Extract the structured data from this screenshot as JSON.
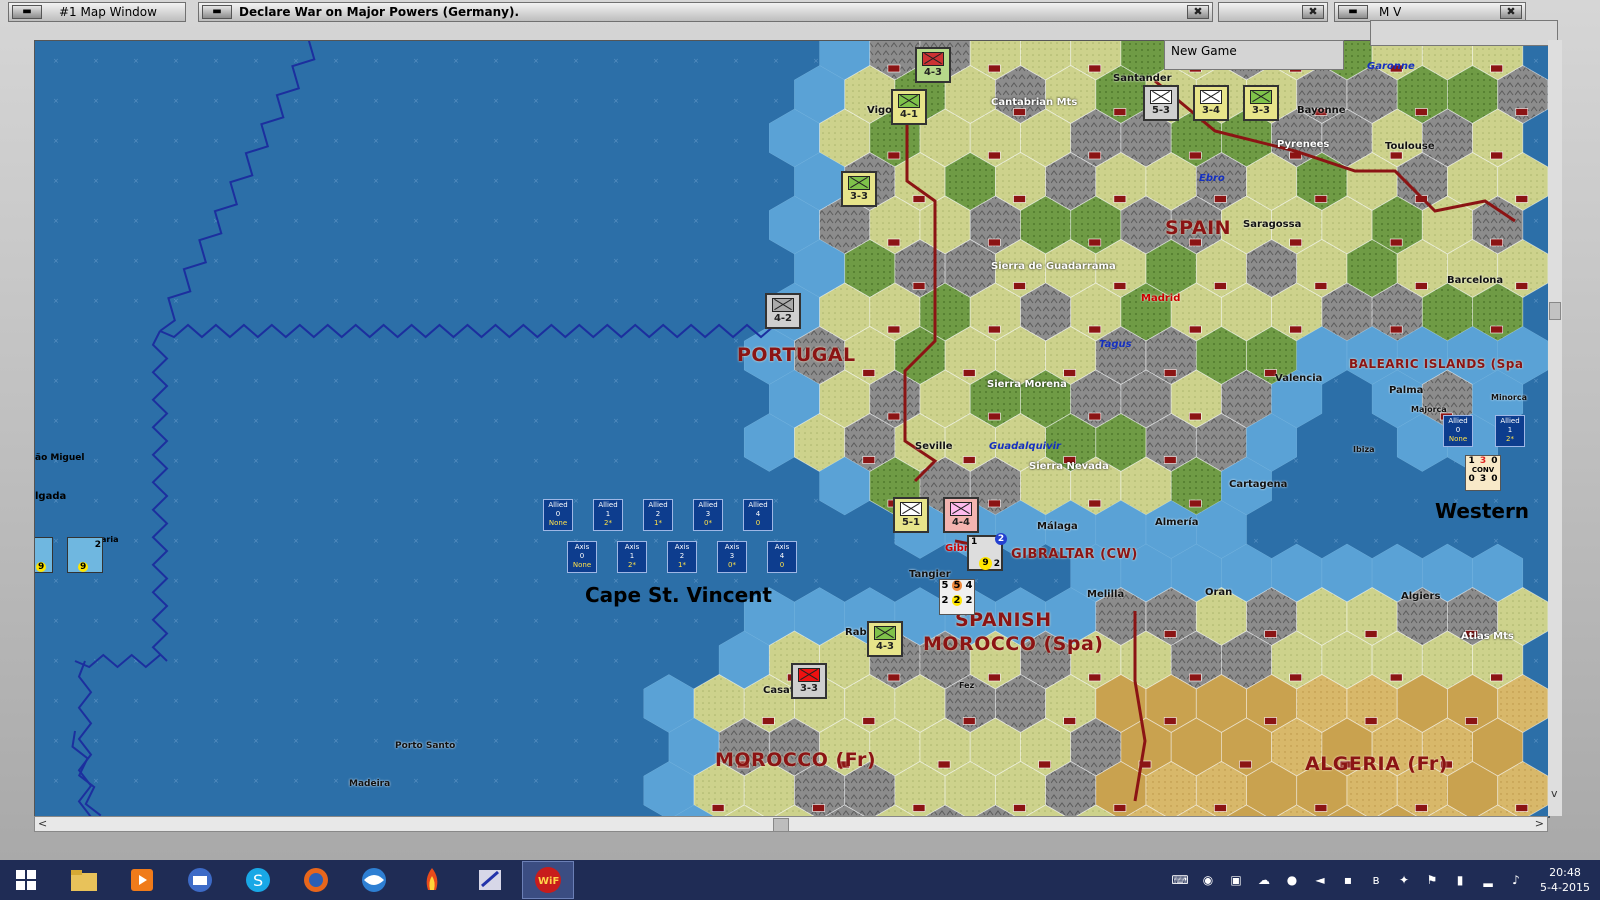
{
  "windows": {
    "map_window_title": "#1 Map Window",
    "main_title": "Declare War on Major Powers (Germany).",
    "new_game": "New Game",
    "mv_title": "M V"
  },
  "close_glyph": "✖",
  "map": {
    "countries": {
      "spain": "SPAIN",
      "portugal": "PORTUGAL",
      "spanish_morocco_1": "SPANISH",
      "spanish_morocco_2": "MOROCCO (Spa)",
      "morocco": "MOROCCO (Fr)",
      "algeria": "ALGERIA (Fr)",
      "gibraltar": "GIBRALTAR (CW)",
      "balearic": "BALEARIC ISLANDS (Spa",
      "western": "Western"
    },
    "sea_zone": "Cape St. Vincent",
    "cities": {
      "santander": "Santander",
      "vigo": "Vigo",
      "bayonne": "Bayonne",
      "toulouse": "Toulouse",
      "saragossa": "Saragossa",
      "barcelona": "Barcelona",
      "madrid": "Madrid",
      "valencia": "Valencia",
      "palma": "Palma",
      "minorca": "Minorca",
      "majorca": "Majorca",
      "ibiza": "Ibiza",
      "seville": "Seville",
      "cartagena": "Cartagena",
      "malaga": "Málaga",
      "almeria": "Almería",
      "gibraltar_city": "Gibr",
      "tangier": "Tangier",
      "melilla": "Melilla",
      "oran": "Oran",
      "algiers": "Algiers",
      "rabat": "Rab",
      "casablanca": "Casat",
      "fez": "Fez",
      "porto_santo": "Porto Santo",
      "madeira": "Madeira",
      "sao_miguel": "ão Miguel",
      "delgada": "lgada",
      "santa_maria": "aria"
    },
    "terrain": {
      "cantabrian": "Cantabrian Mts",
      "pyrenees": "Pyrenees",
      "guadarrama": "Sierra de Guadarrama",
      "morena": "Sierra Morena",
      "nevada": "Sierra Nevada",
      "atlas": "Atlas Mts"
    },
    "rivers": {
      "garonne": "Garonne",
      "ebro": "Ebro",
      "tagus": "Tagus",
      "guadalquivir": "Guadalquivir"
    }
  },
  "sea_boxes": {
    "allied": [
      {
        "side": "Allied",
        "num": "0",
        "status": "None"
      },
      {
        "side": "Allied",
        "num": "1",
        "status": "2*"
      },
      {
        "side": "Allied",
        "num": "2",
        "status": "1*"
      },
      {
        "side": "Allied",
        "num": "3",
        "status": "0*"
      },
      {
        "side": "Allied",
        "num": "4",
        "status": "0"
      }
    ],
    "axis": [
      {
        "side": "Axis",
        "num": "0",
        "status": "None"
      },
      {
        "side": "Axis",
        "num": "1",
        "status": "2*"
      },
      {
        "side": "Axis",
        "num": "2",
        "status": "1*"
      },
      {
        "side": "Axis",
        "num": "3",
        "status": "0*"
      },
      {
        "side": "Axis",
        "num": "4",
        "status": "0"
      }
    ],
    "balearic_allied": [
      {
        "side": "Allied",
        "num": "0",
        "status": "None"
      },
      {
        "side": "Allied",
        "num": "1",
        "status": "2*"
      }
    ]
  },
  "units": [
    {
      "id": "unit-santander-north",
      "value": "4-3"
    },
    {
      "id": "unit-vigo",
      "value": "4-1"
    },
    {
      "id": "unit-galicia",
      "value": "3-3"
    },
    {
      "id": "unit-portugal",
      "value": "4-2"
    },
    {
      "id": "unit-basque-gray",
      "value": "5-3"
    },
    {
      "id": "unit-basque-yellow",
      "value": "3-4"
    },
    {
      "id": "unit-bayonne",
      "value": "3-3"
    },
    {
      "id": "unit-cadiz",
      "value": "5-1"
    },
    {
      "id": "unit-andalusia",
      "value": "4-4"
    },
    {
      "id": "unit-rabat",
      "value": "4-3"
    },
    {
      "id": "unit-casablanca",
      "value": "3-3"
    }
  ],
  "stacks": {
    "gibraltar_top": "1",
    "gibraltar_badge": "2",
    "gibraltar_bottom": "9",
    "gibraltar_right": "2",
    "tangier_row1": [
      "5",
      "5",
      "4"
    ],
    "tangier_row2": [
      "2",
      "2",
      "2"
    ],
    "conv_label": "CONV",
    "conv_top": [
      "1",
      "3",
      "0"
    ],
    "conv_bottom": [
      "0",
      "3",
      "0"
    ],
    "azores_a": "9",
    "azores_b": "9",
    "azores_b_side": "2"
  },
  "taskbar": {
    "time": "20:48",
    "date": "5-4-2015",
    "apps": [
      "windows-start",
      "file-explorer",
      "media-player",
      "thunderbird",
      "skype",
      "firefox",
      "opera",
      "game-flame",
      "game-editor",
      "world-in-flames"
    ],
    "wif_label": "WiF"
  },
  "colors": {
    "sea": "#2c6fa8",
    "coast": "#5aa2d6",
    "clear": "#cdd28c",
    "forest": "#6f9b45",
    "mountain": "#8c8c8c",
    "desert": "#d8b86a",
    "border": "#8b1414"
  }
}
